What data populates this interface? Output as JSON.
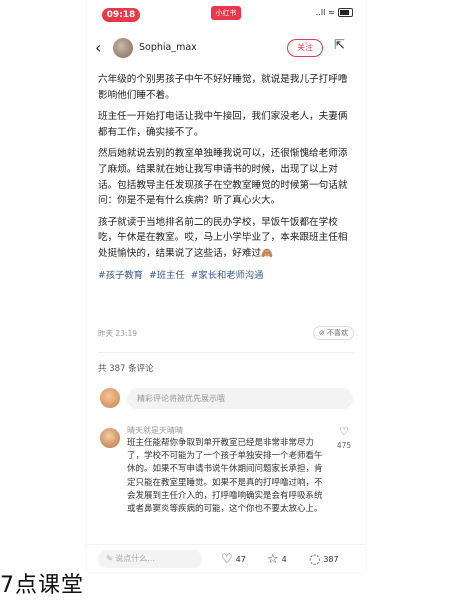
{
  "status_bar": {
    "time": "09:18",
    "app_tag": "小红书",
    "signal": "..ll",
    "wifi": "≈"
  },
  "header": {
    "username": "Sophia_max",
    "follow_label": "关注"
  },
  "post": {
    "paragraphs": [
      "六年级的个别男孩子中午不好好睡觉，就说是我儿子打呼噜影响他们睡不着。",
      "班主任一开始打电话让我中午接回，我们家没老人，夫妻俩都有工作，确实接不了。",
      "然后她就说去别的教室单独睡我说可以，还很惭愧给老师添了麻烦。结果就在她让我写申请书的时候，出现了以上对话。包括教导主任发现孩子在空教室睡觉的时候第一句话就问：你是不是有什么疾病？听了真心火大。",
      "孩子就读于当地排名前二的民办学校，早饭午饭都在学校吃，午休是在教室。哎，马上小学毕业了，本来跟班主任相处挺愉快的，结果说了这些话，好难过🙈"
    ],
    "tags": [
      "#孩子教育",
      "#班主任",
      "#家长和老师沟通"
    ],
    "time": "昨天 23:19",
    "dislike_label": "不喜欢"
  },
  "comments": {
    "count_label": "共 387 条评论",
    "input_placeholder": "精彩评论将被优先展示哦",
    "items": [
      {
        "name": "晴天就是天晴晴",
        "text": "班主任能帮你争取到单开教室已经是非常非常尽力了，学校不可能为了一个孩子单独安排一个老师看午休的。如果不写申请书说午休期间问题家长承担，肯定只能在教室里睡觉。如果不是真的打呼噜过响，不会发展到主任介入的，打呼噜响确实是会有呼吸系统或者鼻窦炎等疾病的可能，这个你也不要太放心上。",
        "likes": "475"
      }
    ]
  },
  "bottom_bar": {
    "say_placeholder": "说点什么...",
    "likes": "47",
    "stars": "4",
    "comments": "387"
  },
  "watermark": "7点课堂"
}
